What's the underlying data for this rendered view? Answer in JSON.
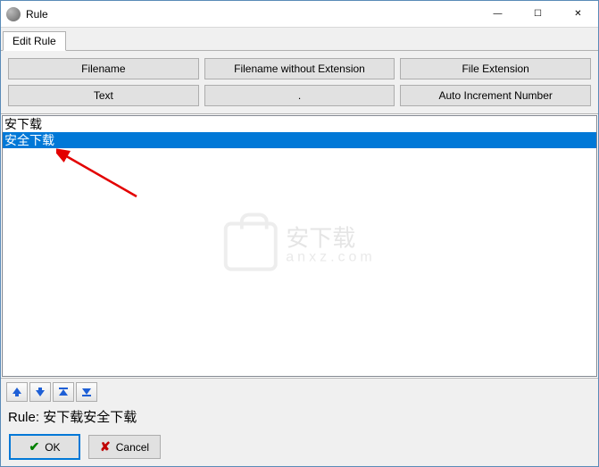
{
  "window": {
    "title": "Rule",
    "controls": {
      "min": "—",
      "max": "☐",
      "close": "✕"
    }
  },
  "tabs": {
    "edit_rule": "Edit Rule"
  },
  "buttons": {
    "filename": "Filename",
    "filename_no_ext": "Filename without Extension",
    "file_ext": "File Extension",
    "text": "Text",
    "dot": ".",
    "auto_inc": "Auto Increment Number"
  },
  "list": {
    "items": [
      {
        "label": "安下载",
        "selected": false
      },
      {
        "label": "安全下载",
        "selected": true
      }
    ]
  },
  "watermark": {
    "line1": "安下载",
    "line2": "anxz.com"
  },
  "rule_label": "Rule:",
  "rule_value": "安下载安全下载",
  "dialog": {
    "ok": "OK",
    "cancel": "Cancel"
  }
}
